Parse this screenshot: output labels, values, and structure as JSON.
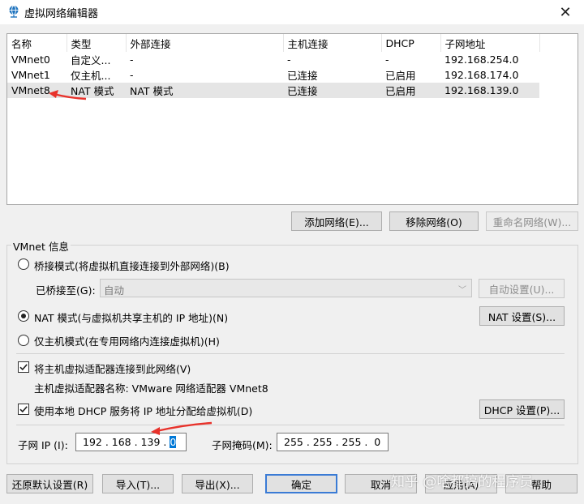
{
  "window": {
    "title": "虚拟网络编辑器"
  },
  "table": {
    "headers": [
      "名称",
      "类型",
      "外部连接",
      "主机连接",
      "DHCP",
      "子网地址"
    ],
    "rows": [
      {
        "name": "VMnet0",
        "type": "自定义...",
        "external": "-",
        "host": "-",
        "dhcp": "-",
        "subnet": "192.168.254.0"
      },
      {
        "name": "VMnet1",
        "type": "仅主机...",
        "external": "-",
        "host": "已连接",
        "dhcp": "已启用",
        "subnet": "192.168.174.0"
      },
      {
        "name": "VMnet8",
        "type": "NAT 模式",
        "external": "NAT 模式",
        "host": "已连接",
        "dhcp": "已启用",
        "subnet": "192.168.139.0"
      }
    ],
    "selected_row": 2
  },
  "list_buttons": {
    "add": "添加网络(E)...",
    "remove": "移除网络(O)",
    "rename": "重命名网络(W)..."
  },
  "vmnet_info": {
    "title": "VMnet 信息",
    "bridged": {
      "label": "桥接模式(将虚拟机直接连接到外部网络)(B)",
      "checked": false
    },
    "bridged_to": {
      "label": "已桥接至(G):",
      "value": "自动",
      "auto_settings": "自动设置(U)..."
    },
    "nat": {
      "label": "NAT 模式(与虚拟机共享主机的 IP 地址)(N)",
      "checked": true,
      "settings": "NAT 设置(S)..."
    },
    "host_only": {
      "label": "仅主机模式(在专用网络内连接虚拟机)(H)",
      "checked": false
    },
    "connect_adapter": {
      "label": "将主机虚拟适配器连接到此网络(V)",
      "checked": true
    },
    "adapter_name": "主机虚拟适配器名称: VMware 网络适配器 VMnet8",
    "use_dhcp": {
      "label": "使用本地 DHCP 服务将 IP 地址分配给虚拟机(D)",
      "checked": true,
      "settings": "DHCP 设置(P)..."
    },
    "subnet_ip": {
      "label": "子网 IP (I):",
      "value": "192 . 168 . 139 . ",
      "last_octet": "0"
    },
    "subnet_mask": {
      "label": "子网掩码(M):",
      "value": "255 . 255 . 255 .  0"
    }
  },
  "bottom_buttons": {
    "restore": "还原默认设置(R)",
    "import": "导入(T)...",
    "export": "导出(X)...",
    "ok": "确定",
    "cancel": "取消",
    "apply": "应用(A)",
    "help": "帮助"
  },
  "watermark": "知乎 @啥都搞的程序员",
  "colors": {
    "annotation_arrow": "#e8322b",
    "selection": "#0078d7"
  }
}
